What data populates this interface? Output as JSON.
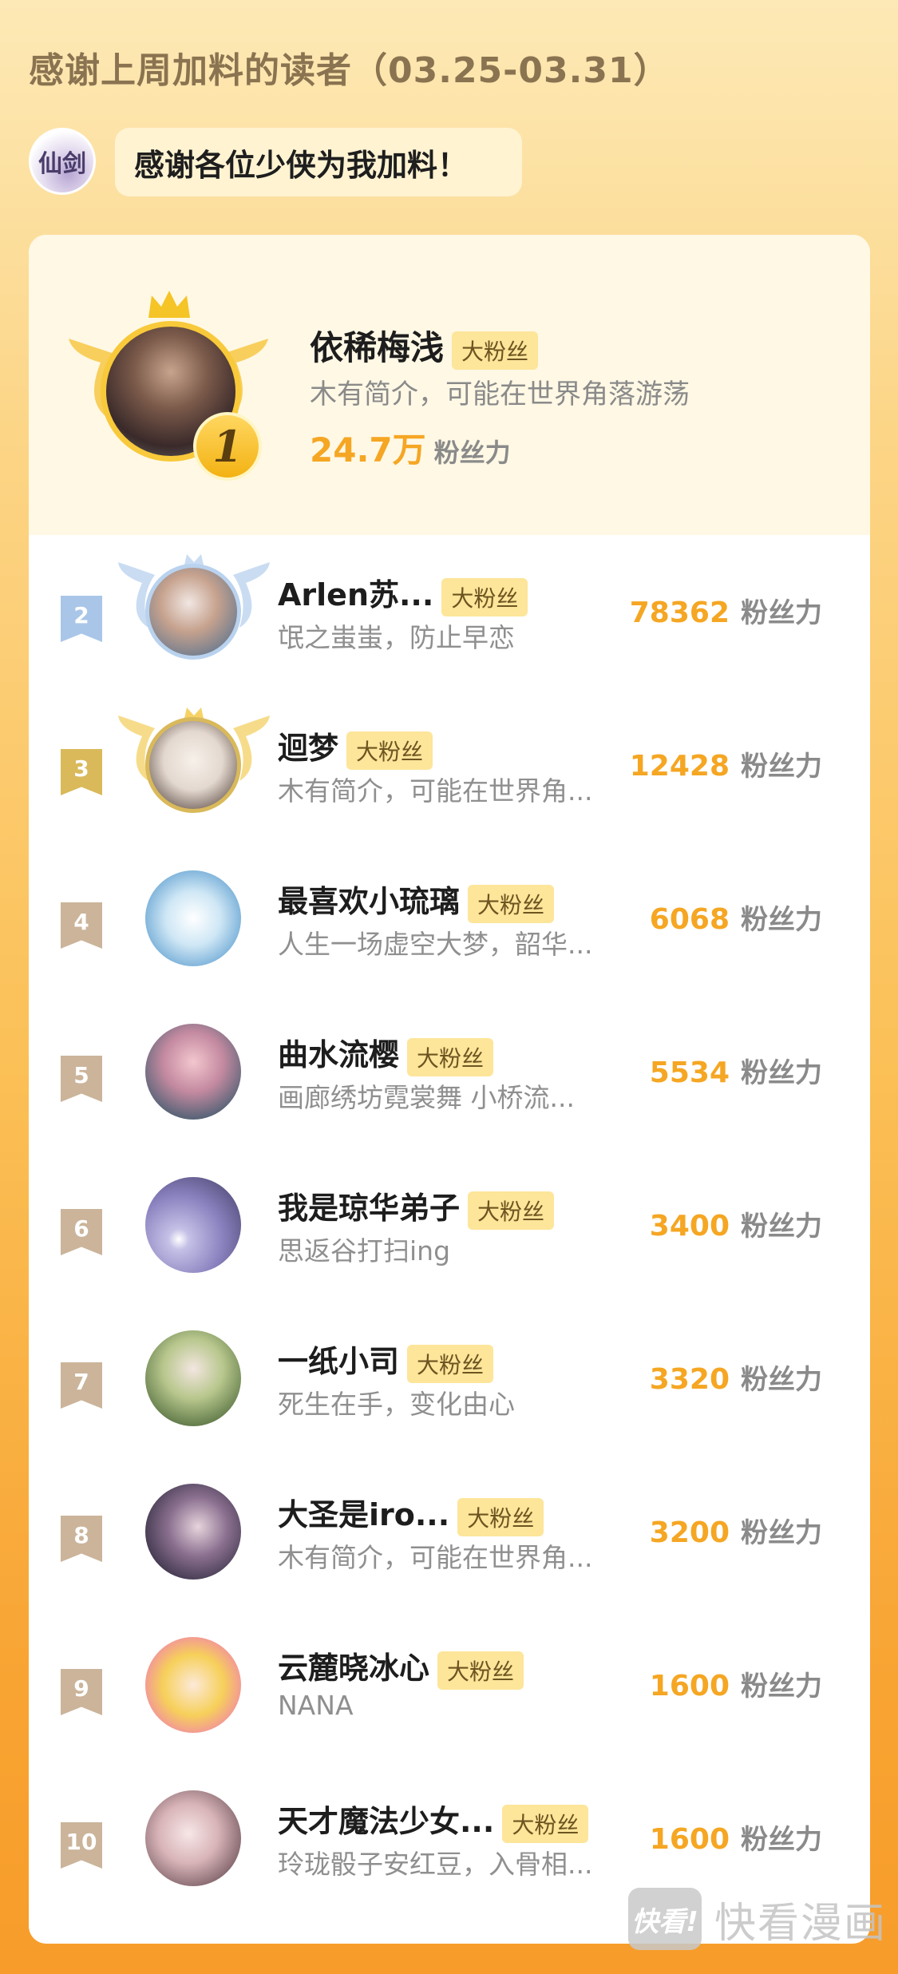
{
  "header": {
    "title": "感谢上周加料的读者（03.25-03.31）"
  },
  "author": {
    "avatar_text": "仙剑",
    "message": "感谢各位少侠为我加料！"
  },
  "tag_label": "大粉丝",
  "unit_label": "粉丝力",
  "top1": {
    "rank": "1",
    "name": "依稀梅浅",
    "bio": "木有简介，可能在世界角落游荡",
    "power": "24.7万"
  },
  "rows": [
    {
      "rank": "2",
      "name": "Arlen苏...",
      "bio": "氓之蚩蚩，防止早恋",
      "power": "78362"
    },
    {
      "rank": "3",
      "name": "迴梦",
      "bio": "木有简介，可能在世界角...",
      "power": "12428"
    },
    {
      "rank": "4",
      "name": "最喜欢小琉璃",
      "bio": "人生一场虚空大梦，韶华...",
      "power": "6068"
    },
    {
      "rank": "5",
      "name": "曲水流樱",
      "bio": "画廊绣坊霓裳舞 小桥流...",
      "power": "5534"
    },
    {
      "rank": "6",
      "name": "我是琼华弟子",
      "bio": "思返谷打扫ing",
      "power": "3400"
    },
    {
      "rank": "7",
      "name": "一纸小司",
      "bio": "死生在手，变化由心",
      "power": "3320"
    },
    {
      "rank": "8",
      "name": "大圣是iro...",
      "bio": "木有简介，可能在世界角...",
      "power": "3200"
    },
    {
      "rank": "9",
      "name": "云麓晓冰心",
      "bio": "NANA",
      "power": "1600"
    },
    {
      "rank": "10",
      "name": "天才魔法少女...",
      "bio": "玲珑骰子安红豆，入骨相...",
      "power": "1600"
    }
  ],
  "watermark": {
    "box_text": "快看!",
    "text": "快看漫画"
  },
  "colors": {
    "accent": "#f5a623",
    "rank2": "#a9c6e8",
    "rank3": "#d9b95a",
    "rank_other": "#cbb49a"
  }
}
